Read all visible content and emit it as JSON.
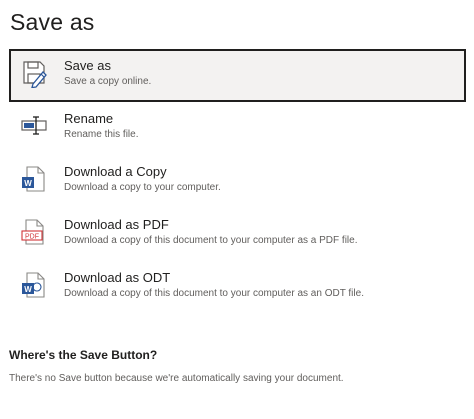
{
  "page": {
    "title": "Save as"
  },
  "options": [
    {
      "label": "Save as",
      "description": "Save a copy online.",
      "icon": "save-as-icon",
      "selected": true
    },
    {
      "label": "Rename",
      "description": "Rename this file.",
      "icon": "rename-icon",
      "selected": false
    },
    {
      "label": "Download a Copy",
      "description": "Download a copy to your computer.",
      "icon": "word-document-icon",
      "selected": false
    },
    {
      "label": "Download as PDF",
      "description": "Download a copy of this document to your computer as a PDF file.",
      "icon": "pdf-document-icon",
      "selected": false
    },
    {
      "label": "Download as ODT",
      "description": "Download a copy of this document to your computer as an ODT file.",
      "icon": "odt-document-icon",
      "selected": false
    }
  ],
  "icons": {
    "pdf_badge": "PDF",
    "word_badge": "W"
  },
  "info": {
    "heading": "Where's the Save Button?",
    "text": "There's no Save button because we're automatically saving your document."
  },
  "colors": {
    "accent_blue": "#2b579a",
    "pdf_red": "#d13438",
    "selected_bg": "#f3f2f1",
    "border_dark": "#201f1e"
  }
}
